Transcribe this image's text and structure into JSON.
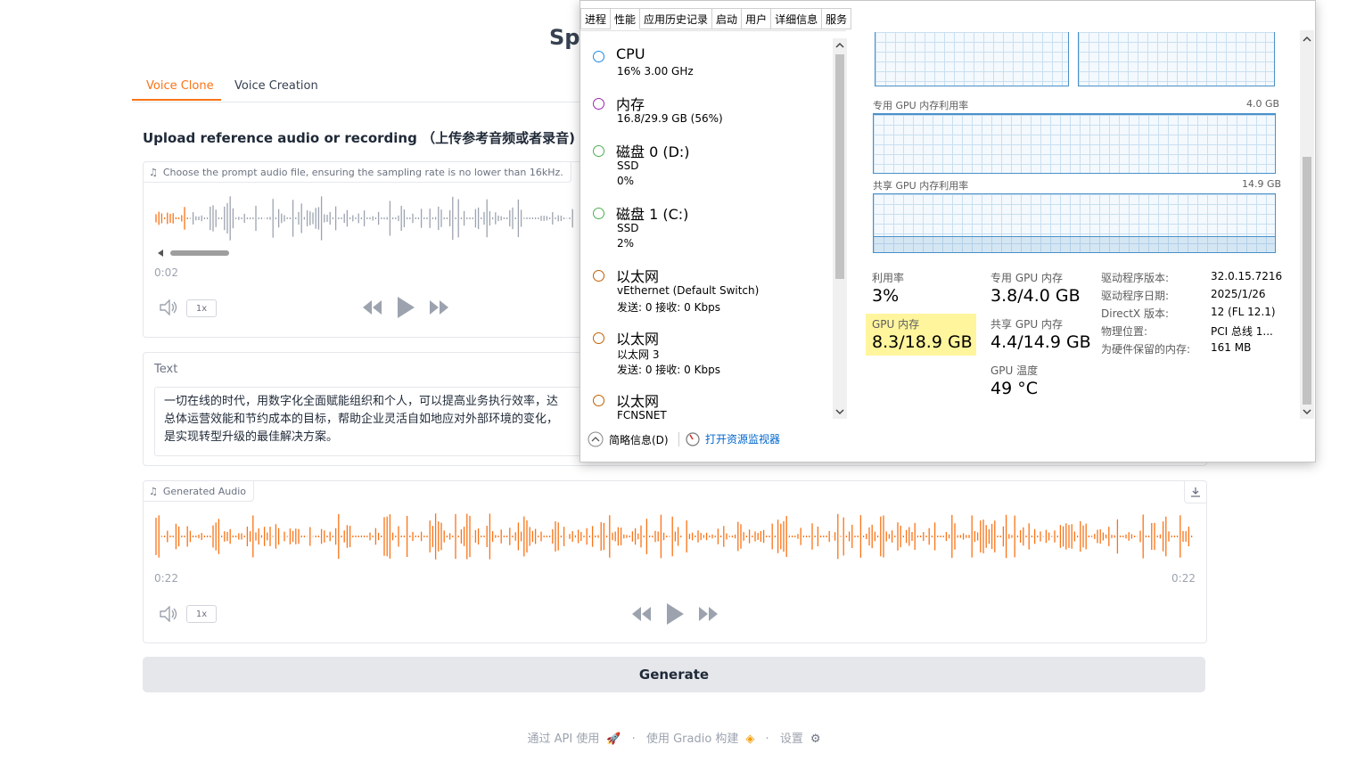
{
  "app": {
    "title_partial": "Spa"
  },
  "tabs": [
    {
      "label": "Voice Clone",
      "active": true
    },
    {
      "label": "Voice Creation",
      "active": false
    }
  ],
  "upload": {
    "title": "Upload reference audio or recording （上传参考音频或者录音)",
    "hint": "Choose the prompt audio file, ensuring the sampling rate is no lower than 16kHz.",
    "time": "0:02",
    "speed": "1x"
  },
  "text": {
    "label": "Text",
    "value": "一切在线的时代，用数字化全面赋能组织和个人，可以提高业务执行效率，达成总体运营效能和节约成本的目标，帮助企业灵活自如地应对外部环境的变化，是实现转型升级的最佳解决方案。",
    "lines": [
      "一切在线的时代，用数字化全面赋能组织和个人，可以提高业务执行效率，达",
      "总体运营效能和节约成本的目标，帮助企业灵活自如地应对外部环境的变化，",
      "是实现转型升级的最佳解决方案。"
    ]
  },
  "generated": {
    "label": "Generated Audio",
    "time_start": "0:22",
    "time_end": "0:22",
    "speed": "1x"
  },
  "generate_button": "Generate",
  "footer": {
    "api": "通过 API 使用",
    "built": "使用 Gradio 构建",
    "settings": "设置",
    "sep": "·"
  },
  "colors": {
    "accent": "#f97316",
    "wave_gray": "#9ca3af",
    "highlight": "#fff59d",
    "graph_border": "#4a90c8"
  },
  "task_manager": {
    "tabs": [
      "进程",
      "性能",
      "应用历史记录",
      "启动",
      "用户",
      "详细信息",
      "服务"
    ],
    "active_tab": "性能",
    "resources": [
      {
        "name": "CPU",
        "line2": "16% 3.00 GHz",
        "line3": "",
        "color": "#1e88e5"
      },
      {
        "name": "内存",
        "line2": "16.8/29.9 GB (56%)",
        "line3": "",
        "color": "#9c27b0"
      },
      {
        "name": "磁盘 0 (D:)",
        "line2": "SSD",
        "line3": "0%",
        "color": "#4caf50"
      },
      {
        "name": "磁盘 1 (C:)",
        "line2": "SSD",
        "line3": "2%",
        "color": "#4caf50"
      },
      {
        "name": "以太网",
        "line2": "vEthernet (Default Switch)",
        "line3": "发送: 0 接收: 0 Kbps",
        "color": "#c06000"
      },
      {
        "name": "以太网",
        "line2": "以太网 3",
        "line3": "发送: 0 接收: 0 Kbps",
        "color": "#c06000"
      },
      {
        "name": "以太网",
        "line2": "FCNSNET",
        "line3": "",
        "color": "#c06000"
      }
    ],
    "graphs": {
      "dedicated_label": "专用 GPU 内存利用率",
      "dedicated_max": "4.0 GB",
      "shared_label": "共享 GPU 内存利用率",
      "shared_max": "14.9 GB"
    },
    "stats": {
      "util_label": "利用率",
      "util_value": "3%",
      "dedicated_label": "专用 GPU 内存",
      "dedicated_value": "3.8/4.0 GB",
      "gpu_mem_label": "GPU 内存",
      "gpu_mem_value": "8.3/18.9 GB",
      "shared_label": "共享 GPU 内存",
      "shared_value": "4.4/14.9 GB",
      "temp_label": "GPU 温度",
      "temp_value": "49 °C"
    },
    "info": [
      {
        "key": "驱动程序版本:",
        "value": "32.0.15.7216"
      },
      {
        "key": "驱动程序日期:",
        "value": "2025/1/26"
      },
      {
        "key": "DirectX 版本:",
        "value": "12 (FL 12.1)"
      },
      {
        "key": "物理位置:",
        "value": "PCI 总线 1..."
      },
      {
        "key": "为硬件保留的内存:",
        "value": "161 MB"
      }
    ],
    "footer": {
      "summary": "简略信息(D)",
      "monitor": "打开资源监视器"
    }
  }
}
